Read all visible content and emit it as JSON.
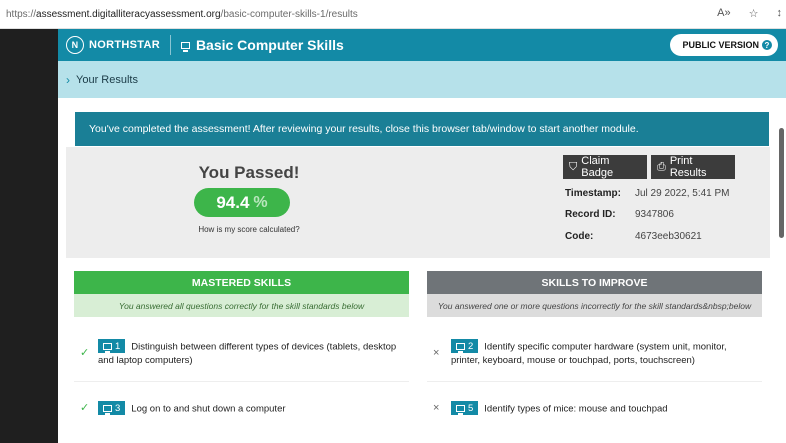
{
  "browser": {
    "url_prefix": "https://",
    "url_host": "assessment.digitalliteracyassessment.org",
    "url_path": "/basic-computer-skills-1/results"
  },
  "header": {
    "brand": "NORTHSTAR",
    "module_title": "Basic Computer Skills",
    "public_version_label": "PUBLIC VERSION"
  },
  "breadcrumb": {
    "label": "Your Results"
  },
  "banner": {
    "text": "You've completed the assessment! After reviewing your results, close this browser tab/window to start another module."
  },
  "result": {
    "headline": "You Passed!",
    "score": "94.4",
    "score_unit": "%",
    "how_calculated": "How is my score calculated?",
    "claim_badge_label": "Claim Badge",
    "print_results_label": "Print Results",
    "timestamp_key": "Timestamp:",
    "timestamp_value": "Jul 29 2022, 5:41 PM",
    "record_key": "Record ID:",
    "record_value": "9347806",
    "code_key": "Code:",
    "code_value": "4673eeb30621"
  },
  "mastered": {
    "title": "MASTERED SKILLS",
    "subtitle": "You answered all questions correctly for the skill standards below",
    "items": [
      {
        "num": "1",
        "text": "Distinguish between different types of devices (tablets, desktop and laptop computers)"
      },
      {
        "num": "3",
        "text": "Log on to and shut down a computer"
      }
    ]
  },
  "improve": {
    "title": "SKILLS TO IMPROVE",
    "subtitle": "You answered one or more questions incorrectly for the skill standards&nbsp;below",
    "items": [
      {
        "num": "2",
        "text": "Identify specific computer hardware (system unit, monitor, printer, keyboard, mouse or touchpad, ports, touchscreen)"
      },
      {
        "num": "5",
        "text": "Identify types of mice: mouse and touchpad"
      }
    ]
  },
  "colors": {
    "teal": "#138aa6",
    "green": "#3db54a",
    "gray": "#6f7478"
  }
}
